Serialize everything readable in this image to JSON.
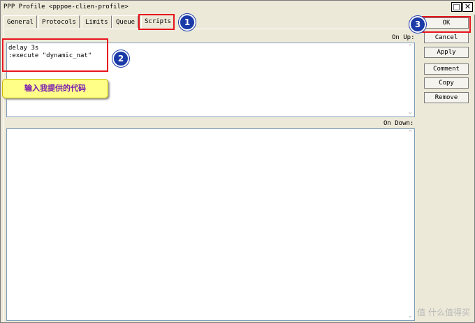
{
  "window": {
    "title": "PPP Profile <pppoe-clien-profile>",
    "minimize_symbol": "□",
    "close_symbol": "✕"
  },
  "tabs": [
    {
      "label": "General"
    },
    {
      "label": "Protocols"
    },
    {
      "label": "Limits"
    },
    {
      "label": "Queue"
    },
    {
      "label": "Scripts",
      "active": true
    }
  ],
  "scripts": {
    "on_up_label": "On Up:",
    "on_up_value": "delay 3s\n:execute \"dynamic_nat\"",
    "on_down_label": "On Down:",
    "on_down_value": ""
  },
  "buttons": {
    "ok": "OK",
    "cancel": "Cancel",
    "apply": "Apply",
    "comment": "Comment",
    "copy": "Copy",
    "remove": "Remove"
  },
  "annotations": {
    "badge1": "1",
    "badge2": "2",
    "badge3": "3",
    "callout_text": "输入我提供的代码",
    "highlight_color": "#e8141d",
    "badge_color": "#1a3aa8"
  },
  "watermark": "值 什么值得买"
}
